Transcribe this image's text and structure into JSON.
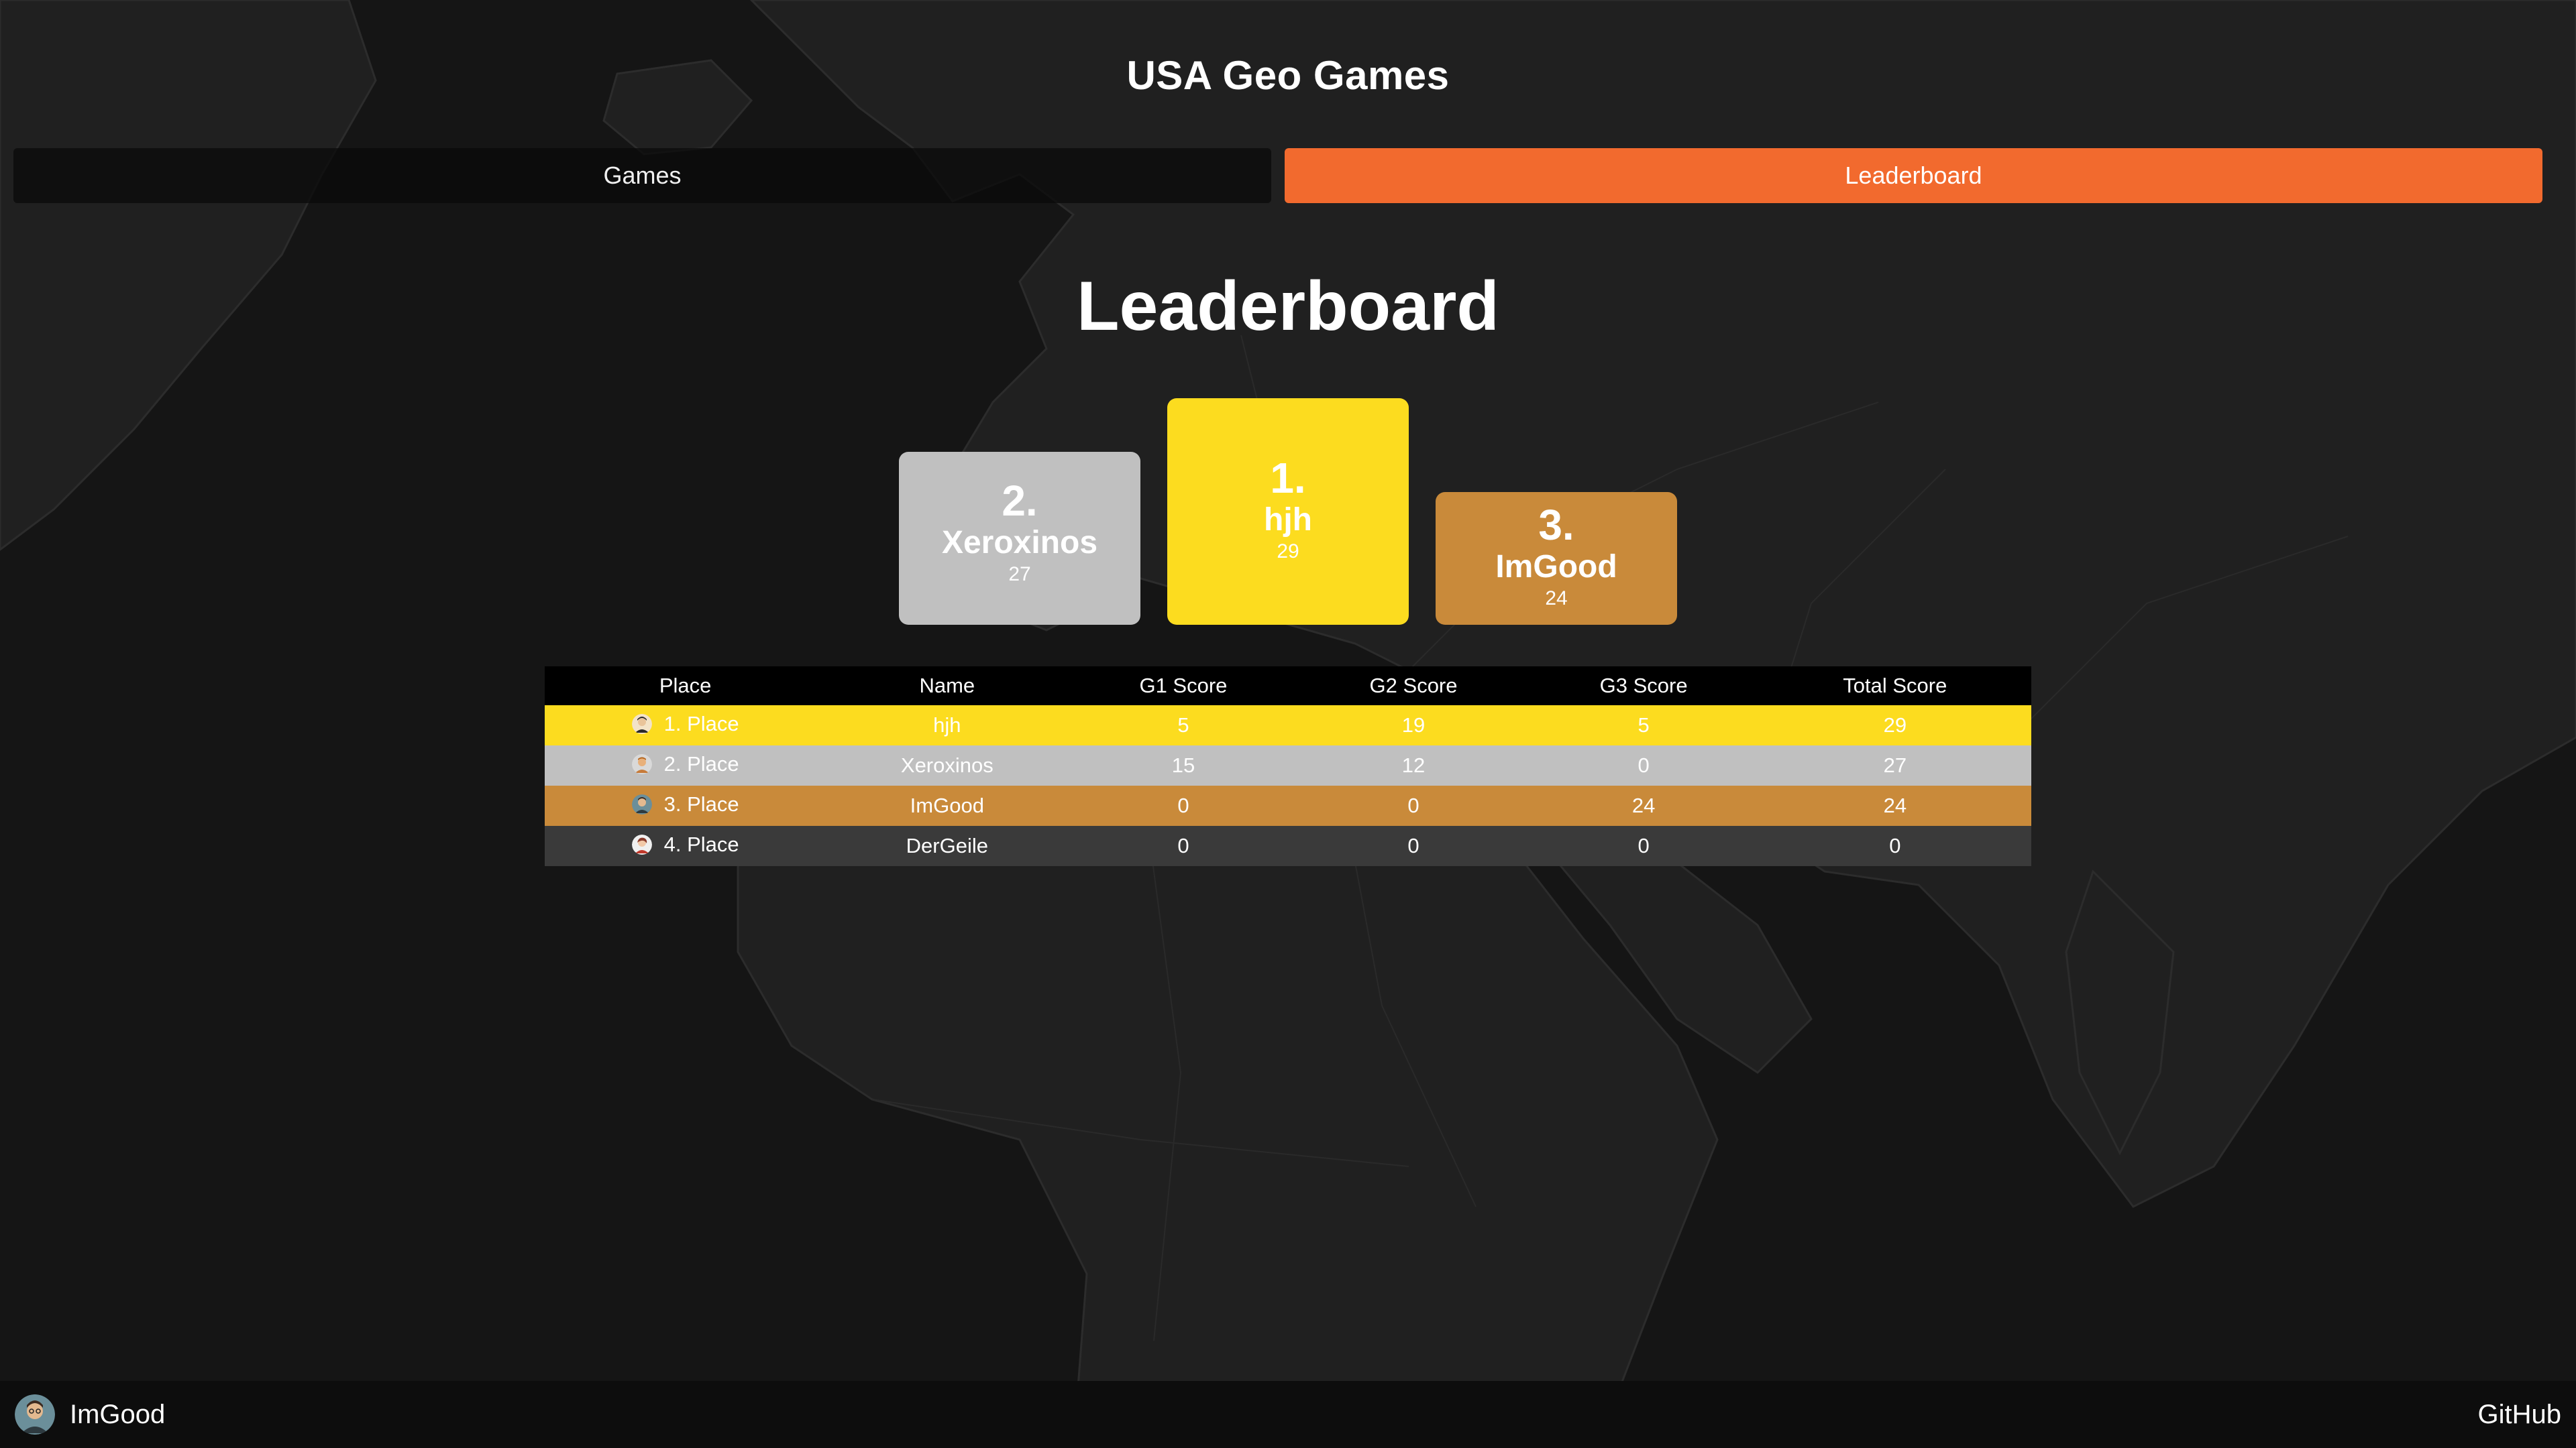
{
  "app": {
    "title": "USA Geo Games"
  },
  "nav": {
    "tabs": [
      {
        "label": "Games",
        "active": false
      },
      {
        "label": "Leaderboard",
        "active": true
      }
    ],
    "active_color": "#f26a2e"
  },
  "leaderboard": {
    "heading": "Leaderboard",
    "podium": {
      "first": {
        "rank": "1.",
        "name": "hjh",
        "score": "29",
        "color": "#fcdc1f"
      },
      "second": {
        "rank": "2.",
        "name": "Xeroxinos",
        "score": "27",
        "color": "#c0c0c0"
      },
      "third": {
        "rank": "3.",
        "name": "ImGood",
        "score": "24",
        "color": "#c98a3a"
      }
    },
    "table": {
      "headers": [
        "Place",
        "Name",
        "G1 Score",
        "G2 Score",
        "G3 Score",
        "Total Score"
      ],
      "rows": [
        {
          "place": "1. Place",
          "name": "hjh",
          "g1": "5",
          "g2": "19",
          "g3": "5",
          "total": "29",
          "avatar": "avatar-icon"
        },
        {
          "place": "2. Place",
          "name": "Xeroxinos",
          "g1": "15",
          "g2": "12",
          "g3": "0",
          "total": "27",
          "avatar": "avatar-icon"
        },
        {
          "place": "3. Place",
          "name": "ImGood",
          "g1": "0",
          "g2": "0",
          "g3": "24",
          "total": "24",
          "avatar": "avatar-icon"
        },
        {
          "place": "4. Place",
          "name": "DerGeile",
          "g1": "0",
          "g2": "0",
          "g3": "0",
          "total": "0",
          "avatar": "avatar-icon"
        }
      ]
    }
  },
  "footer": {
    "user_name": "ImGood",
    "github_label": "GitHub"
  }
}
